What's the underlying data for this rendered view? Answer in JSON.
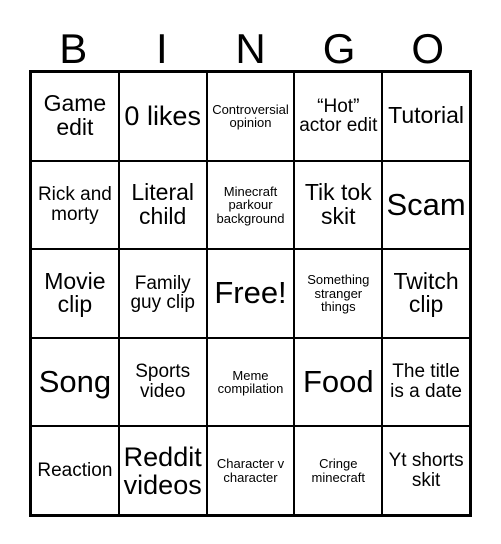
{
  "card": {
    "header_letters": [
      "B",
      "I",
      "N",
      "G",
      "O"
    ],
    "border_color": "#000000",
    "background_color": "#ffffff",
    "text_color": "#000000",
    "rows": 5,
    "columns": 5,
    "free_space_index": 12,
    "cells": [
      {
        "text": "Game edit",
        "size": "md"
      },
      {
        "text": "0 likes",
        "size": "lg"
      },
      {
        "text": "Controversial opinion",
        "size": "xs"
      },
      {
        "text": "“Hot” actor edit",
        "size": "sm"
      },
      {
        "text": "Tutorial",
        "size": "md"
      },
      {
        "text": "Rick and morty",
        "size": "sm"
      },
      {
        "text": "Literal child",
        "size": "md"
      },
      {
        "text": "Minecraft parkour background",
        "size": "xs"
      },
      {
        "text": "Tik tok skit",
        "size": "md"
      },
      {
        "text": "Scam",
        "size": "xl"
      },
      {
        "text": "Movie clip",
        "size": "md"
      },
      {
        "text": "Family guy clip",
        "size": "sm"
      },
      {
        "text": "Free!",
        "size": "xl"
      },
      {
        "text": "Something stranger things",
        "size": "xs"
      },
      {
        "text": "Twitch clip",
        "size": "md"
      },
      {
        "text": "Song",
        "size": "xl"
      },
      {
        "text": "Sports video",
        "size": "sm"
      },
      {
        "text": "Meme compilation",
        "size": "xs"
      },
      {
        "text": "Food",
        "size": "xl"
      },
      {
        "text": "The title is a date",
        "size": "sm"
      },
      {
        "text": "Reaction",
        "size": "sm"
      },
      {
        "text": "Reddit videos",
        "size": "lg"
      },
      {
        "text": "Character v character",
        "size": "xs"
      },
      {
        "text": "Cringe minecraft",
        "size": "xs"
      },
      {
        "text": "Yt shorts skit",
        "size": "sm"
      }
    ]
  }
}
